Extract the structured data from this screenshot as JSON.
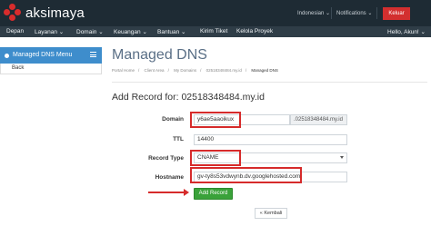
{
  "header": {
    "brand": "aksimaya",
    "language": "Indonesian ⌄",
    "notifications": "Notifications ⌄",
    "logout_label": "Keluar"
  },
  "nav": {
    "items": [
      "Depan",
      "Layanan ⌄",
      "Domain ⌄",
      "Keuangan ⌄",
      "Bantuan ⌄",
      "Kirim Tiket",
      "Kelola Proyek"
    ],
    "user": "Hello, Akun! ⌄"
  },
  "sidebar": {
    "title": "Managed DNS Menu",
    "back": "Back"
  },
  "main": {
    "title": "Managed DNS",
    "breadcrumb": [
      "Portal Home",
      "Client Area",
      "My Domains",
      "02518348484.my.id",
      "Managed DNS"
    ],
    "section_title": "Add Record for: 02518348484.my.id"
  },
  "form": {
    "domain_label": "Domain",
    "domain_value": "y6ae5aaoikux",
    "domain_suffix": ".02518348484.my.id",
    "ttl_label": "TTL",
    "ttl_value": "14400",
    "record_type_label": "Record Type",
    "record_type_value": "CNAME",
    "hostname_label": "Hostname",
    "hostname_value": "gv-ty8s53vdwynb.dv.googlehosted.com",
    "add_button": "Add Record",
    "back_button": "« Kembali"
  },
  "colors": {
    "header_bg": "#1e2b34",
    "nav_bg": "#2f3d47",
    "accent_blue": "#3e8dcc",
    "logout_red": "#d32f2f",
    "annotation_red": "#d62b2b",
    "button_green": "#3aa23a"
  }
}
